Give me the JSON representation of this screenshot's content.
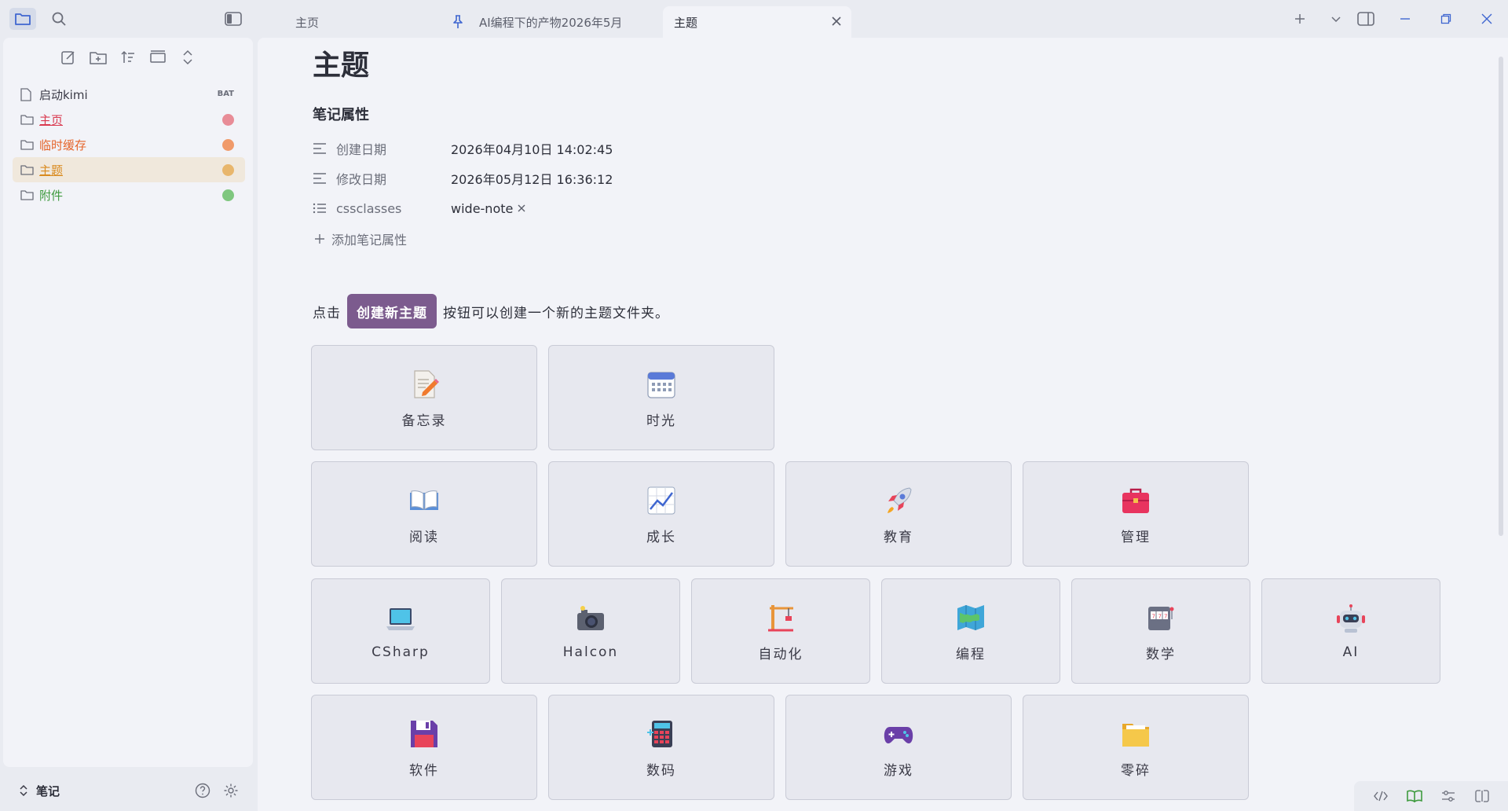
{
  "tabs": [
    {
      "label": "主页",
      "pinned": false,
      "active": false
    },
    {
      "label": "AI编程下的产物2026年5月",
      "pinned": true,
      "active": false
    },
    {
      "label": "主题",
      "pinned": false,
      "active": true
    }
  ],
  "sidebar": {
    "items": [
      {
        "label": "启动kimi",
        "type": "file",
        "badge": "BAT",
        "color": "#3a3a46",
        "underline": false
      },
      {
        "label": "主页",
        "type": "folder",
        "dot": "#e88c97",
        "color": "#d9394f",
        "underline": true
      },
      {
        "label": "临时缓存",
        "type": "folder",
        "dot": "#f09a6a",
        "color": "#e5642a",
        "underline": false
      },
      {
        "label": "主题",
        "type": "folder",
        "dot": "#e8b66c",
        "color": "#d98a1e",
        "underline": true,
        "selected": true
      },
      {
        "label": "附件",
        "type": "folder",
        "dot": "#7fc77f",
        "color": "#3f9b3f",
        "underline": false
      }
    ],
    "vault_name": "笔记"
  },
  "main": {
    "title": "主题",
    "properties_heading": "笔记属性",
    "properties": [
      {
        "name": "创建日期",
        "value": "2026年04月10日 14:02:45"
      },
      {
        "name": "修改日期",
        "value": "2026年05月12日 16:36:12"
      },
      {
        "name": "cssclasses",
        "value": "wide-note"
      }
    ],
    "add_property": "添加笔记属性",
    "intro_before": "点击",
    "create_button": "创建新主题",
    "intro_after": "按钮可以创建一个新的主题文件夹。",
    "cards": [
      {
        "label": "备忘录",
        "icon": "memo-icon"
      },
      {
        "label": "时光",
        "icon": "calendar-icon"
      },
      {
        "label": "阅读",
        "icon": "open-book-icon"
      },
      {
        "label": "成长",
        "icon": "chart-up-icon"
      },
      {
        "label": "教育",
        "icon": "rocket-icon"
      },
      {
        "label": "管理",
        "icon": "briefcase-icon"
      },
      {
        "label": "CSharp",
        "icon": "laptop-icon"
      },
      {
        "label": "Halcon",
        "icon": "camera-icon"
      },
      {
        "label": "自动化",
        "icon": "crane-icon"
      },
      {
        "label": "编程",
        "icon": "map-icon"
      },
      {
        "label": "数学",
        "icon": "slot-machine-icon"
      },
      {
        "label": "AI",
        "icon": "robot-icon"
      },
      {
        "label": "软件",
        "icon": "floppy-disk-icon"
      },
      {
        "label": "数码",
        "icon": "calculator-icon"
      },
      {
        "label": "游戏",
        "icon": "gamepad-icon"
      },
      {
        "label": "零碎",
        "icon": "folder-icon"
      }
    ]
  },
  "colors": {
    "accent": "#7c5b8e",
    "folder_icon": "#4a6fd1"
  }
}
